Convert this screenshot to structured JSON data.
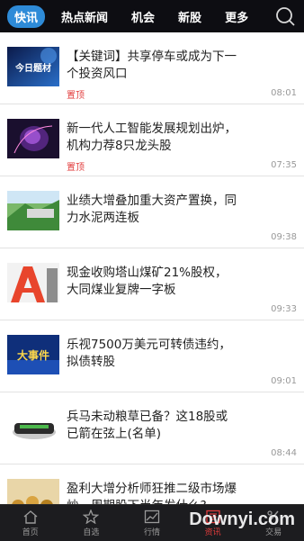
{
  "tabs": [
    {
      "label": "快讯",
      "active": true
    },
    {
      "label": "热点新闻",
      "active": false
    },
    {
      "label": "机会",
      "active": false
    },
    {
      "label": "新股",
      "active": false
    },
    {
      "label": "更多",
      "active": false
    }
  ],
  "search_icon": "search-icon",
  "news": [
    {
      "title": "【关键词】共享停车或成为下一个投资风口",
      "pinned": "置顶",
      "time": "08:01",
      "thumb": "今日题材"
    },
    {
      "title": "新一代人工智能发展规划出炉，机构力荐8只龙头股",
      "pinned": "置顶",
      "time": "07:35",
      "thumb": ""
    },
    {
      "title": "业绩大增叠加重大资产置换，同力水泥两连板",
      "pinned": "",
      "time": "09:38",
      "thumb": ""
    },
    {
      "title": "现金收购塔山煤矿21%股权，大同煤业复牌一字板",
      "pinned": "",
      "time": "09:33",
      "thumb": ""
    },
    {
      "title": "乐视7500万美元可转债违约，拟债转股",
      "pinned": "",
      "time": "09:01",
      "thumb": "大事件"
    },
    {
      "title": "兵马未动粮草已备？这18股或已箭在弦上(名单)",
      "pinned": "",
      "time": "08:44",
      "thumb": ""
    },
    {
      "title": "盈利大增分析师狂推二级市场爆炒，周期股下半年发什么?",
      "pinned": "",
      "time": "",
      "thumb": ""
    }
  ],
  "nav": [
    {
      "label": "首页",
      "icon": "home-icon",
      "active": false
    },
    {
      "label": "自选",
      "icon": "star-icon",
      "active": false
    },
    {
      "label": "行情",
      "icon": "chart-icon",
      "active": false
    },
    {
      "label": "资讯",
      "icon": "news-icon",
      "active": true
    },
    {
      "label": "交易",
      "icon": "trade-icon",
      "active": false
    }
  ],
  "watermark": "Downyi.com",
  "colors": {
    "accent": "#2e8bd8",
    "pinned": "#e23c3c",
    "active_nav": "#e23c3c"
  }
}
